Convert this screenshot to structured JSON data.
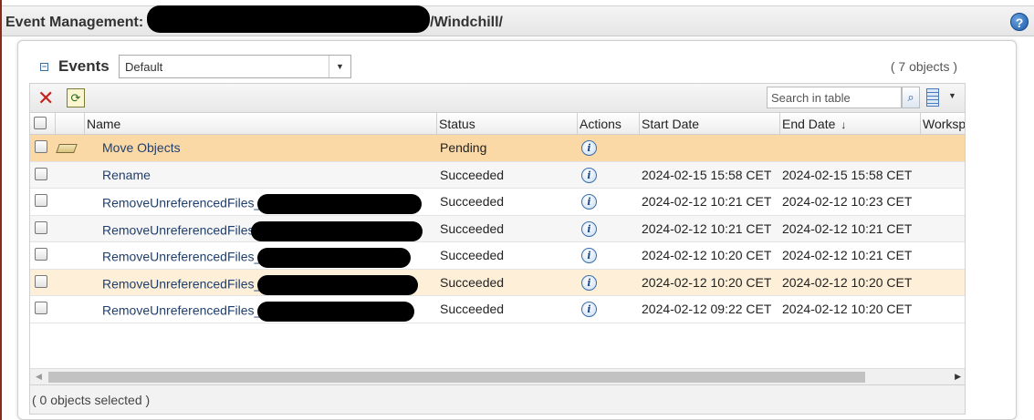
{
  "header": {
    "title_prefix": "Event Management:",
    "title_suffix": "/Windchill/",
    "help_glyph": "?"
  },
  "panel": {
    "title": "Events",
    "view_select_value": "Default",
    "object_count": "( 7 objects )"
  },
  "toolbar": {
    "search_placeholder": "Search in table"
  },
  "table": {
    "columns": [
      "Name",
      "Status",
      "Actions",
      "Start Date",
      "End Date",
      "Workspa"
    ],
    "rows": [
      {
        "name": "Move Objects",
        "status": "Pending",
        "start": "",
        "end": ""
      },
      {
        "name": "Rename",
        "status": "Succeeded",
        "start": "2024-02-15 15:58 CET",
        "end": "2024-02-15 15:58 CET"
      },
      {
        "name": "RemoveUnreferencedFiles_",
        "status": "Succeeded",
        "start": "2024-02-12 10:21 CET",
        "end": "2024-02-12 10:23 CET"
      },
      {
        "name": "RemoveUnreferencedFiles",
        "status": "Succeeded",
        "start": "2024-02-12 10:21 CET",
        "end": "2024-02-12 10:21 CET"
      },
      {
        "name": "RemoveUnreferencedFiles_",
        "status": "Succeeded",
        "start": "2024-02-12 10:20 CET",
        "end": "2024-02-12 10:21 CET"
      },
      {
        "name": "RemoveUnreferencedFiles_",
        "status": "Succeeded",
        "start": "2024-02-12 10:20 CET",
        "end": "2024-02-12 10:20 CET"
      },
      {
        "name": "RemoveUnreferencedFiles_",
        "status": "Succeeded",
        "start": "2024-02-12 09:22 CET",
        "end": "2024-02-12 10:20 CET"
      }
    ]
  },
  "footer": {
    "selection_text": "( 0 objects selected )"
  },
  "colors": {
    "selected_row": "#fbd9a6",
    "hover_row": "#fdefd8",
    "link": "#1f3f6e",
    "delete": "#c8201a"
  }
}
